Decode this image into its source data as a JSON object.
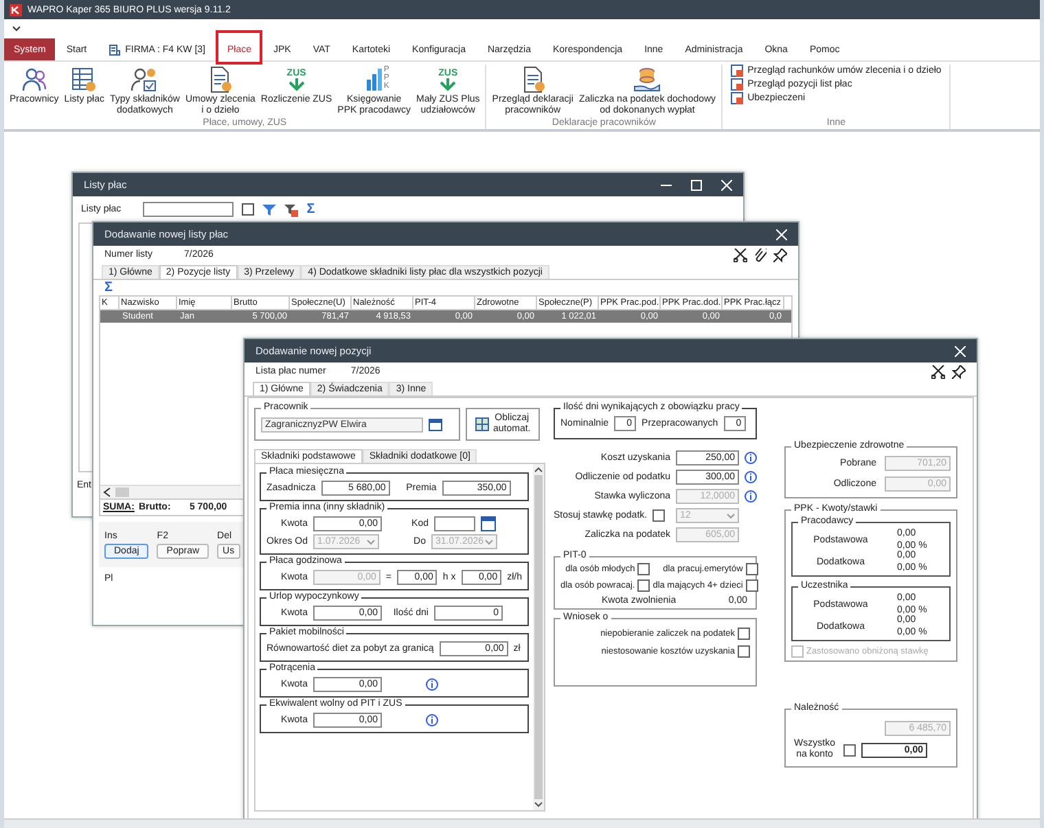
{
  "app": {
    "title": "WAPRO Kaper 365 BIURO PLUS wersja 9.11.2"
  },
  "menu_tabs": [
    {
      "label": "System",
      "kind": "system",
      "selected": false
    },
    {
      "label": "Start",
      "kind": "tab",
      "selected": false
    },
    {
      "label": "FIRMA : F4 KW [3]",
      "kind": "firm",
      "selected": false
    },
    {
      "label": "Płace",
      "kind": "tab",
      "selected": true
    },
    {
      "label": "JPK",
      "kind": "tab",
      "selected": false
    },
    {
      "label": "VAT",
      "kind": "tab",
      "selected": false
    },
    {
      "label": "Kartoteki",
      "kind": "tab",
      "selected": false
    },
    {
      "label": "Konfiguracja",
      "kind": "tab",
      "selected": false
    },
    {
      "label": "Narzędzia",
      "kind": "tab",
      "selected": false
    },
    {
      "label": "Korespondencja",
      "kind": "tab",
      "selected": false
    },
    {
      "label": "Inne",
      "kind": "tab",
      "selected": false
    },
    {
      "label": "Administracja",
      "kind": "tab",
      "selected": false
    },
    {
      "label": "Okna",
      "kind": "tab",
      "selected": false
    },
    {
      "label": "Pomoc",
      "kind": "tab",
      "selected": false
    }
  ],
  "ribbon": {
    "groups": [
      {
        "label": "Płace, umowy, ZUS",
        "kind": "large",
        "items": [
          {
            "lines": [
              "Pracownicy"
            ]
          },
          {
            "lines": [
              "Listy płac"
            ]
          },
          {
            "lines": [
              "Typy składników",
              "dodatkowych"
            ]
          },
          {
            "lines": [
              "Umowy zlecenia",
              "i o dzieło"
            ]
          },
          {
            "lines": [
              "Rozliczenie ZUS"
            ],
            "icon_text": "ZUS"
          },
          {
            "lines": [
              "Księgowanie",
              "PPK pracodawcy"
            ],
            "icon_text": "PPK"
          },
          {
            "lines": [
              "Mały ZUS Plus",
              "udziałowców"
            ],
            "icon_text": "ZUS"
          }
        ]
      },
      {
        "label": "Deklaracje pracowników",
        "kind": "large",
        "items": [
          {
            "lines": [
              "Przegląd deklaracji",
              "pracowników"
            ]
          },
          {
            "lines": [
              "Zaliczka na podatek dochodowy",
              "od dokonanych wypłat"
            ]
          }
        ]
      },
      {
        "label": "Inne",
        "kind": "small",
        "items": [
          {
            "lines": [
              "Przegląd rachunków umów zlecenia i o dzieło"
            ]
          },
          {
            "lines": [
              "Przegląd pozycji list płac"
            ]
          },
          {
            "lines": [
              "Ubezpieczeni"
            ]
          }
        ]
      }
    ]
  },
  "payroll_window": {
    "title": "Listy płac",
    "filter_label": "Listy płac",
    "sum_symbol": "Σ",
    "enter_label": "Ent"
  },
  "list_window": {
    "title": "Dodawanie nowej listy płac",
    "number_label": "Numer listy",
    "number": "7/2026",
    "tabs": [
      {
        "label": "1) Główne",
        "selected": false
      },
      {
        "label": "2) Pozycje listy",
        "selected": true
      },
      {
        "label": "3) Przelewy",
        "selected": false
      },
      {
        "label": "4) Dodatkowe składniki listy płac dla wszystkich pozycji",
        "selected": false
      }
    ],
    "sum_symbol": "Σ",
    "columns": [
      "K",
      "Nazwisko",
      "Imię",
      "Brutto",
      "Społeczne(U)",
      "Należność",
      "PIT-4",
      "Zdrowotne",
      "Społeczne(P)",
      "PPK Prac.pod.",
      "PPK Prac.dod.",
      "PPK Prac.łącz"
    ],
    "rows": [
      {
        "selected": true,
        "cells": [
          "",
          "Student",
          "Jan",
          "5 700,00",
          "781,47",
          "4 918,53",
          "0,00",
          "0,00",
          "1 022,01",
          "0,00",
          "0,00",
          "0,0"
        ]
      }
    ],
    "summary": {
      "label": "SUMA:",
      "field": "Brutto:",
      "value": "5 700,00"
    },
    "actions": [
      {
        "key": "Ins",
        "label": "Dodaj",
        "focused": true
      },
      {
        "key": "F2",
        "label": "Popraw",
        "focused": false
      },
      {
        "key": "Del",
        "label": "Us",
        "focused": false
      }
    ],
    "footer_text": "Pl"
  },
  "item_window": {
    "title": "Dodawanie nowej pozycji",
    "number_label": "Lista płac numer",
    "number": "7/2026",
    "tabs": [
      {
        "label": "1) Główne",
        "selected": true
      },
      {
        "label": "2) Świadczenia",
        "selected": false
      },
      {
        "label": "3) Inne",
        "selected": false
      }
    ],
    "employee": {
      "legend": "Pracownik",
      "value": "ZagranicznyzPW Elwira"
    },
    "auto_button": {
      "lines": [
        "Obliczaj",
        "automat."
      ]
    },
    "days": {
      "legend": "Ilość dni wynikających z obowiązku pracy",
      "fields": [
        {
          "label": "Nominalnie",
          "value": "0"
        },
        {
          "label": "Przepracowanych",
          "value": "0"
        }
      ]
    },
    "subtabs": [
      {
        "label": "Składniki podstawowe",
        "selected": true
      },
      {
        "label": "Składniki dodatkowe [0]",
        "selected": false
      }
    ],
    "groups": [
      {
        "legend": "Płaca miesięczna",
        "rows": [
          [
            {
              "kind": "label",
              "text": "Zasadnicza"
            },
            {
              "kind": "field",
              "value": "5 680,00",
              "disabled": false
            },
            {
              "kind": "label",
              "text": "Premia"
            },
            {
              "kind": "field",
              "value": "350,00",
              "disabled": false
            }
          ]
        ]
      },
      {
        "legend": "Premia inna (inny składnik)",
        "rows": [
          [
            {
              "kind": "label",
              "text": "Kwota"
            },
            {
              "kind": "field",
              "value": "0,00",
              "disabled": false
            },
            {
              "kind": "label",
              "text": "Kod"
            },
            {
              "kind": "field-short",
              "disabled": false
            },
            {
              "kind": "picker"
            }
          ],
          [
            {
              "kind": "label",
              "text": "Okres  Od"
            },
            {
              "kind": "date",
              "value": "1.07.2026",
              "disabled": true
            },
            {
              "kind": "label",
              "text": "Do"
            },
            {
              "kind": "date",
              "value": "31.07.2026",
              "disabled": true
            }
          ]
        ]
      },
      {
        "legend": "Płaca godzinowa",
        "rows": [
          [
            {
              "kind": "label",
              "text": "Kwota"
            },
            {
              "kind": "field",
              "value": "0,00",
              "disabled": true
            },
            {
              "kind": "unit",
              "text": "="
            },
            {
              "kind": "field-short",
              "value": "0,00",
              "disabled": false
            },
            {
              "kind": "unit",
              "text": "h x"
            },
            {
              "kind": "field-short",
              "value": "0,00",
              "disabled": false
            },
            {
              "kind": "unit",
              "text": "zł/h"
            }
          ]
        ]
      },
      {
        "legend": "Urlop wypoczynkowy",
        "rows": [
          [
            {
              "kind": "label",
              "text": "Kwota"
            },
            {
              "kind": "field",
              "value": "0,00",
              "disabled": false
            },
            {
              "kind": "label",
              "text": "Ilość dni"
            },
            {
              "kind": "field",
              "value": "0",
              "disabled": false
            }
          ]
        ]
      },
      {
        "legend": "Pakiet mobilności",
        "rows": [
          [
            {
              "kind": "wide-label",
              "text": "Równowartość diet za pobyt za granicą"
            },
            {
              "kind": "field",
              "value": "0,00",
              "disabled": false
            },
            {
              "kind": "unit",
              "text": "zł"
            }
          ]
        ]
      },
      {
        "legend": "Potrącenia",
        "rows": [
          [
            {
              "kind": "label",
              "text": "Kwota"
            },
            {
              "kind": "field",
              "value": "0,00",
              "disabled": false
            },
            {
              "kind": "info"
            }
          ]
        ]
      },
      {
        "legend": "Ekwiwalent wolny od PIT i ZUS",
        "rows": [
          [
            {
              "kind": "label",
              "text": "Kwota"
            },
            {
              "kind": "field",
              "value": "0,00",
              "disabled": false
            },
            {
              "kind": "info"
            }
          ]
        ]
      }
    ],
    "tax": [
      {
        "kind": "field",
        "label": "Koszt uzyskania",
        "value": "250,00",
        "disabled": false,
        "info": true
      },
      {
        "kind": "field",
        "label": "Odliczenie od podatku",
        "value": "300,00",
        "disabled": false,
        "info": true
      },
      {
        "kind": "field",
        "label": "Stawka wyliczona",
        "value": "12,0000",
        "disabled": true,
        "info": true
      },
      {
        "kind": "checkbox-select",
        "label": "Stosuj stawkę podatk.",
        "checked": false,
        "value": "12",
        "disabled": true,
        "info": false
      },
      {
        "kind": "field",
        "label": "Zaliczka na podatek",
        "value": "605,00",
        "disabled": true,
        "info": false
      }
    ],
    "pit0": {
      "legend": "PIT-0",
      "options": [
        {
          "label": "dla osób młodych",
          "checked": false
        },
        {
          "label": "dla pracuj.emerytów",
          "checked": false
        },
        {
          "label": "dla osób powracaj.",
          "checked": false
        },
        {
          "label": "dla mających 4+ dzieci",
          "checked": false
        }
      ],
      "exemption_label": "Kwota zwolnienia",
      "exemption_value": "0,00"
    },
    "request": {
      "legend": "Wniosek o",
      "options": [
        {
          "label": "niepobieranie zaliczek na podatek",
          "checked": false
        },
        {
          "label": "niestosowanie  kosztów uzyskania",
          "checked": false
        }
      ]
    },
    "health": {
      "legend": "Ubezpieczenie zdrowotne",
      "fields": [
        {
          "label": "Pobrane",
          "value": "701,20",
          "disabled": true
        },
        {
          "label": "Odliczone",
          "value": "0,00",
          "disabled": true
        }
      ]
    },
    "ppk": {
      "legend": "PPK - Kwoty/stawki",
      "sections": [
        {
          "legend": "Pracodawcy",
          "rows": [
            {
              "label": "Podstawowa",
              "amount": "0,00",
              "rate": "0,00",
              "unit": "%"
            },
            {
              "label": "Dodatkowa",
              "amount": "0,00",
              "rate": "0,00",
              "unit": "%"
            }
          ]
        },
        {
          "legend": "Uczestnika",
          "rows": [
            {
              "label": "Podstawowa",
              "amount": "0,00",
              "rate": "0,00",
              "unit": "%"
            },
            {
              "label": "Dodatkowa",
              "amount": "0,00",
              "rate": "0,00",
              "unit": "%"
            }
          ]
        }
      ],
      "reduced": {
        "label": "Zastosowano obniżoną stawkę",
        "checked": false,
        "disabled": true
      }
    },
    "due": {
      "legend": "Należność",
      "total": {
        "value": "6 485,70",
        "disabled": true
      },
      "all_to_account": {
        "label": "Wszystko na konto",
        "checked": false
      },
      "account": {
        "value": "0,00",
        "disabled": false
      }
    }
  }
}
